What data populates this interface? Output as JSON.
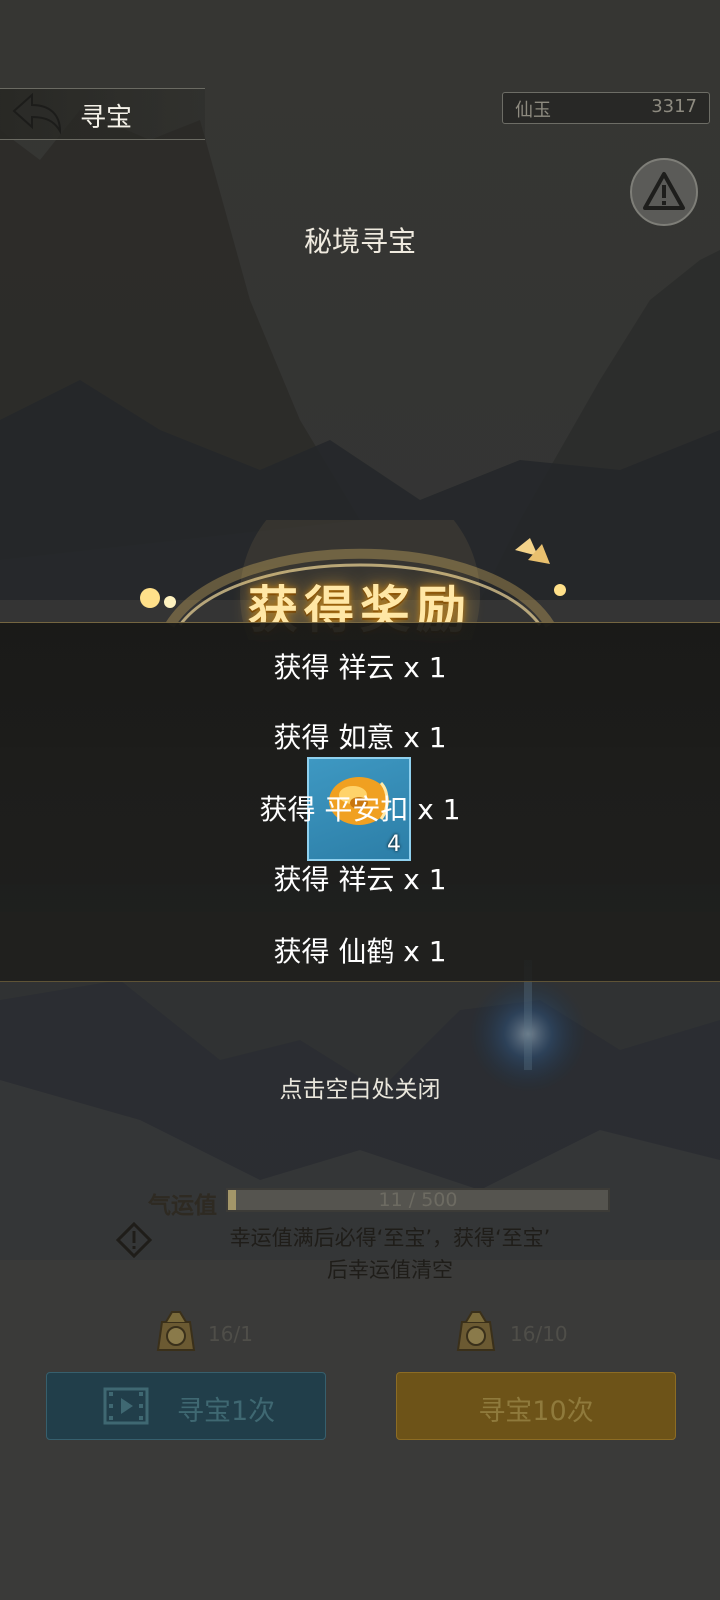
{
  "header": {
    "title": "寻宝",
    "currency_label": "仙玉",
    "currency_value": "3317"
  },
  "section_title": "秘境寻宝",
  "reward": {
    "title": "获得奖励",
    "lines": [
      "获得 祥云 x 1",
      "获得 如意 x 1",
      "获得 平安扣 x 1",
      "获得 祥云 x 1",
      "获得 仙鹤 x 1"
    ],
    "item_count": "4"
  },
  "close_hint": "点击空白处关闭",
  "luck": {
    "label": "气运值",
    "progress_text": "11 / 500",
    "progress_fraction": 0.022,
    "description_line1": "幸运值满后必得‘至宝’，获得‘至宝’",
    "description_line2": "后幸运值清空"
  },
  "draws": {
    "once_cost": "16/1",
    "ten_cost": "16/10",
    "once_label": "寻宝1次",
    "ten_label": "寻宝10次"
  },
  "colors": {
    "gold_title": "#ffe7a6",
    "item_slot_blue": "#3e98c2",
    "button_once": "#213e4a",
    "button_ten": "#6d5318"
  },
  "icons": [
    "back-arrow-icon",
    "warning-icon",
    "info-icon",
    "coin-pouch-icon",
    "video-icon"
  ]
}
